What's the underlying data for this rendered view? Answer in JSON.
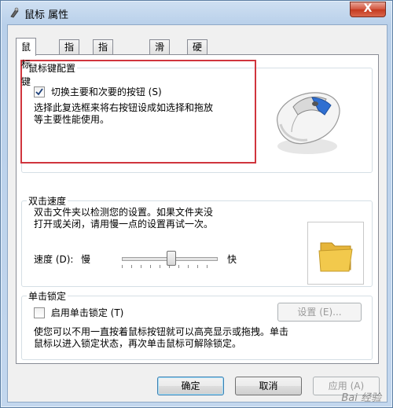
{
  "window": {
    "title": "鼠标 属性",
    "close_label": "X"
  },
  "tabs": [
    "鼠标键",
    "指针",
    "指针选项",
    "滑轮",
    "硬件"
  ],
  "button_config": {
    "group_label": "鼠标键配置",
    "checkbox_label": "切换主要和次要的按钮 (S)",
    "checkbox_checked": true,
    "description_line1": "选择此复选框来将右按钮设成如选择和拖放",
    "description_line2": "等主要性能使用。"
  },
  "double_click": {
    "group_label": "双击速度",
    "description_line1": "双击文件夹以检测您的设置。如果文件夹没",
    "description_line2": "打开或关闭，请用慢一点的设置再试一次。",
    "speed_label": "速度 (D):",
    "slow_label": "慢",
    "fast_label": "快",
    "speed_value": 0.52
  },
  "click_lock": {
    "group_label": "单击锁定",
    "checkbox_label": "启用单击锁定 (T)",
    "checkbox_checked": false,
    "settings_button": "设置 (E)...",
    "description_line1": "使您可以不用一直按着鼠标按钮就可以高亮显示或拖拽。单击",
    "description_line2": "鼠标以进入锁定状态，再次单击鼠标可解除锁定。"
  },
  "footer": {
    "ok": "确定",
    "cancel": "取消",
    "apply": "应用 (A)"
  },
  "watermark": "Bai 经验",
  "colors": {
    "highlight": "#d0353d",
    "folder": "#f2c94c",
    "mouse_accent": "#2f6fd1"
  }
}
